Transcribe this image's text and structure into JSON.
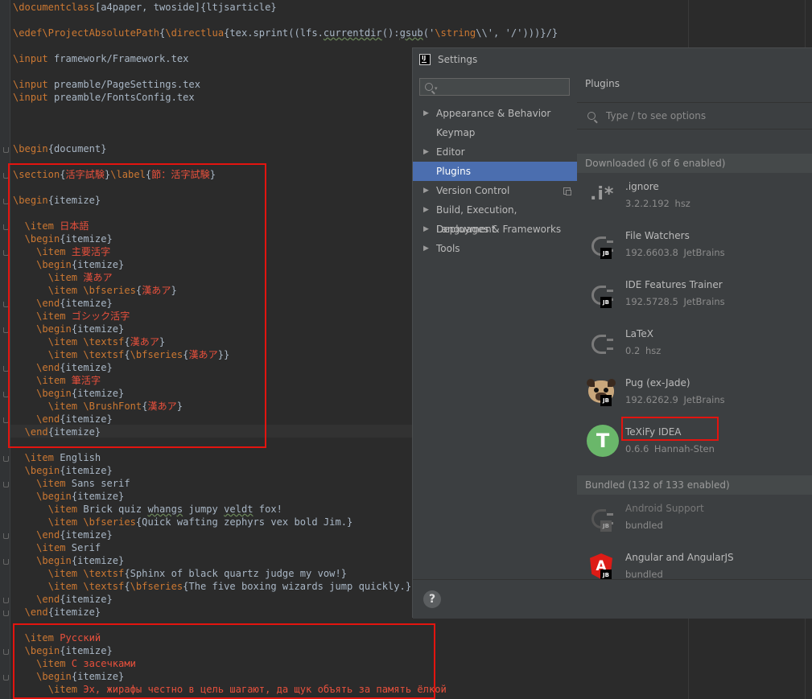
{
  "editor": {
    "lines": [
      [
        {
          "t": "\\documentclass",
          "c": "kw"
        },
        {
          "t": "[a4paper, twoside]{ltjsarticle}"
        }
      ],
      [],
      [
        {
          "t": "\\edef",
          "c": "kw"
        },
        {
          "t": "\\ProjectAbsolutePath",
          "c": "kw"
        },
        {
          "t": "{"
        },
        {
          "t": "\\directlua",
          "c": "kw"
        },
        {
          "t": "{tex.sprint((lfs."
        },
        {
          "t": "currentdir",
          "c": "sq"
        },
        {
          "t": "():"
        },
        {
          "t": "gsub",
          "c": "sq"
        },
        {
          "t": "('"
        },
        {
          "t": "\\string",
          "c": "kw"
        },
        {
          "t": "\\\\', '/')))}/}"
        }
      ],
      [],
      [
        {
          "t": "\\input",
          "c": "kw"
        },
        {
          "t": " framework/Framework.tex"
        }
      ],
      [],
      [
        {
          "t": "\\input",
          "c": "kw"
        },
        {
          "t": " preamble/PageSettings.tex"
        }
      ],
      [
        {
          "t": "\\input",
          "c": "kw"
        },
        {
          "t": " preamble/FontsConfig.tex"
        }
      ],
      [],
      [],
      [],
      [
        {
          "t": "\\begin",
          "c": "kw"
        },
        {
          "t": "{document}"
        }
      ],
      [],
      [
        {
          "t": "\\section",
          "c": "kw"
        },
        {
          "t": "{"
        },
        {
          "t": "活字試験",
          "c": "rd"
        },
        {
          "t": "}"
        },
        {
          "t": "\\label",
          "c": "kw"
        },
        {
          "t": "{"
        },
        {
          "t": "節：活字試験",
          "c": "rd"
        },
        {
          "t": "}"
        }
      ],
      [],
      [
        {
          "t": "\\begin",
          "c": "kw"
        },
        {
          "t": "{itemize}"
        }
      ],
      [],
      [
        {
          "t": "  "
        },
        {
          "t": "\\item",
          "c": "kw"
        },
        {
          "t": " 日本語",
          "c": "rd"
        }
      ],
      [
        {
          "t": "  "
        },
        {
          "t": "\\begin",
          "c": "kw"
        },
        {
          "t": "{itemize}"
        }
      ],
      [
        {
          "t": "    "
        },
        {
          "t": "\\item",
          "c": "kw"
        },
        {
          "t": " 主要活字",
          "c": "rd"
        }
      ],
      [
        {
          "t": "    "
        },
        {
          "t": "\\begin",
          "c": "kw"
        },
        {
          "t": "{itemize}"
        }
      ],
      [
        {
          "t": "      "
        },
        {
          "t": "\\item",
          "c": "kw"
        },
        {
          "t": " 漢あア",
          "c": "rd"
        }
      ],
      [
        {
          "t": "      "
        },
        {
          "t": "\\item",
          "c": "kw"
        },
        {
          "t": " "
        },
        {
          "t": "\\bfseries",
          "c": "kw"
        },
        {
          "t": "{"
        },
        {
          "t": "漢あア",
          "c": "rd"
        },
        {
          "t": "}"
        }
      ],
      [
        {
          "t": "    "
        },
        {
          "t": "\\end",
          "c": "kw"
        },
        {
          "t": "{itemize}"
        }
      ],
      [
        {
          "t": "    "
        },
        {
          "t": "\\item",
          "c": "kw"
        },
        {
          "t": " ゴシック活字",
          "c": "rd"
        }
      ],
      [
        {
          "t": "    "
        },
        {
          "t": "\\begin",
          "c": "kw"
        },
        {
          "t": "{itemize}"
        }
      ],
      [
        {
          "t": "      "
        },
        {
          "t": "\\item",
          "c": "kw"
        },
        {
          "t": " "
        },
        {
          "t": "\\textsf",
          "c": "kw"
        },
        {
          "t": "{"
        },
        {
          "t": "漢あア",
          "c": "rd"
        },
        {
          "t": "}"
        }
      ],
      [
        {
          "t": "      "
        },
        {
          "t": "\\item",
          "c": "kw"
        },
        {
          "t": " "
        },
        {
          "t": "\\textsf",
          "c": "kw"
        },
        {
          "t": "{"
        },
        {
          "t": "\\bfseries",
          "c": "kw"
        },
        {
          "t": "{"
        },
        {
          "t": "漢あア",
          "c": "rd"
        },
        {
          "t": "}}"
        }
      ],
      [
        {
          "t": "    "
        },
        {
          "t": "\\end",
          "c": "kw"
        },
        {
          "t": "{itemize}"
        }
      ],
      [
        {
          "t": "    "
        },
        {
          "t": "\\item",
          "c": "kw"
        },
        {
          "t": " 筆活字",
          "c": "rd"
        }
      ],
      [
        {
          "t": "    "
        },
        {
          "t": "\\begin",
          "c": "kw"
        },
        {
          "t": "{itemize}"
        }
      ],
      [
        {
          "t": "      "
        },
        {
          "t": "\\item",
          "c": "kw"
        },
        {
          "t": " "
        },
        {
          "t": "\\BrushFont",
          "c": "kw"
        },
        {
          "t": "{"
        },
        {
          "t": "漢あア",
          "c": "rd"
        },
        {
          "t": "}"
        }
      ],
      [
        {
          "t": "    "
        },
        {
          "t": "\\end",
          "c": "kw"
        },
        {
          "t": "{itemize}"
        }
      ],
      [
        {
          "t": "  "
        },
        {
          "t": "\\end",
          "c": "kw"
        },
        {
          "t": "{itemize}"
        }
      ],
      [],
      [
        {
          "t": "  "
        },
        {
          "t": "\\item",
          "c": "kw"
        },
        {
          "t": " English"
        }
      ],
      [
        {
          "t": "  "
        },
        {
          "t": "\\begin",
          "c": "kw"
        },
        {
          "t": "{itemize}"
        }
      ],
      [
        {
          "t": "    "
        },
        {
          "t": "\\item",
          "c": "kw"
        },
        {
          "t": " Sans serif"
        }
      ],
      [
        {
          "t": "    "
        },
        {
          "t": "\\begin",
          "c": "kw"
        },
        {
          "t": "{itemize}"
        }
      ],
      [
        {
          "t": "      "
        },
        {
          "t": "\\item",
          "c": "kw"
        },
        {
          "t": " Brick quiz "
        },
        {
          "t": "whangs",
          "c": "sq"
        },
        {
          "t": " jumpy "
        },
        {
          "t": "veldt",
          "c": "sq"
        },
        {
          "t": " fox!"
        }
      ],
      [
        {
          "t": "      "
        },
        {
          "t": "\\item",
          "c": "kw"
        },
        {
          "t": " "
        },
        {
          "t": "\\bfseries",
          "c": "kw"
        },
        {
          "t": "{Quick wafting zephyrs vex bold Jim.}"
        }
      ],
      [
        {
          "t": "    "
        },
        {
          "t": "\\end",
          "c": "kw"
        },
        {
          "t": "{itemize}"
        }
      ],
      [
        {
          "t": "    "
        },
        {
          "t": "\\item",
          "c": "kw"
        },
        {
          "t": " Serif"
        }
      ],
      [
        {
          "t": "    "
        },
        {
          "t": "\\begin",
          "c": "kw"
        },
        {
          "t": "{itemize}"
        }
      ],
      [
        {
          "t": "      "
        },
        {
          "t": "\\item",
          "c": "kw"
        },
        {
          "t": " "
        },
        {
          "t": "\\textsf",
          "c": "kw"
        },
        {
          "t": "{Sphinx of black quartz judge my vow!}"
        }
      ],
      [
        {
          "t": "      "
        },
        {
          "t": "\\item",
          "c": "kw"
        },
        {
          "t": " "
        },
        {
          "t": "\\textsf",
          "c": "kw"
        },
        {
          "t": "{"
        },
        {
          "t": "\\bfseries",
          "c": "kw"
        },
        {
          "t": "{The five boxing wizards jump quickly.}}"
        }
      ],
      [
        {
          "t": "    "
        },
        {
          "t": "\\end",
          "c": "kw"
        },
        {
          "t": "{itemize}"
        }
      ],
      [
        {
          "t": "  "
        },
        {
          "t": "\\end",
          "c": "kw"
        },
        {
          "t": "{itemize}"
        }
      ],
      [],
      [
        {
          "t": "  "
        },
        {
          "t": "\\item",
          "c": "kw"
        },
        {
          "t": " Русский",
          "c": "rd"
        }
      ],
      [
        {
          "t": "  "
        },
        {
          "t": "\\begin",
          "c": "kw"
        },
        {
          "t": "{itemize}"
        }
      ],
      [
        {
          "t": "    "
        },
        {
          "t": "\\item",
          "c": "kw"
        },
        {
          "t": " С засечками",
          "c": "rd"
        }
      ],
      [
        {
          "t": "    "
        },
        {
          "t": "\\begin",
          "c": "kw"
        },
        {
          "t": "{itemize}"
        }
      ],
      [
        {
          "t": "      "
        },
        {
          "t": "\\item",
          "c": "kw"
        },
        {
          "t": " Эх, жирафы честно в цель шагают, да щук объять за память ёлкой",
          "c": "rd"
        }
      ]
    ]
  },
  "settings": {
    "title": "Settings",
    "app_icon_label": "IJ",
    "search_value": "",
    "nav": [
      {
        "label": "Appearance & Behavior",
        "arrow": "▶"
      },
      {
        "label": "Keymap",
        "arrow": ""
      },
      {
        "label": "Editor",
        "arrow": "▶"
      },
      {
        "label": "Plugins",
        "arrow": "",
        "selected": true
      },
      {
        "label": "Version Control",
        "arrow": "▶"
      },
      {
        "label": "Build, Execution, Deployment",
        "arrow": "▶"
      },
      {
        "label": "Languages & Frameworks",
        "arrow": "▶"
      },
      {
        "label": "Tools",
        "arrow": "▶"
      }
    ],
    "plugins_header": "Plugins",
    "options_placeholder": "Type / to see options",
    "downloaded_header": "Downloaded (6 of 6 enabled)",
    "bundled_header": "Bundled (132 of 133 enabled)",
    "downloaded": [
      {
        "name": ".ignore",
        "version": "3.2.2.192",
        "vendor": "hsz",
        "icon": "dot-ignore-icon"
      },
      {
        "name": "File Watchers",
        "version": "192.6603.8",
        "vendor": "JetBrains",
        "icon": "plugin-plug-icon",
        "jb": true
      },
      {
        "name": "IDE Features Trainer",
        "version": "192.5728.5",
        "vendor": "JetBrains",
        "icon": "plugin-plug-icon",
        "jb": true
      },
      {
        "name": "LaTeX",
        "version": "0.2",
        "vendor": "hsz",
        "icon": "plugin-plug-icon"
      },
      {
        "name": "Pug (ex-Jade)",
        "version": "192.6262.9",
        "vendor": "JetBrains",
        "icon": "pug-icon",
        "jb": true
      },
      {
        "name": "TeXiFy IDEA",
        "version": "0.6.6",
        "vendor": "Hannah-Sten",
        "icon": "texify-icon"
      }
    ],
    "bundled": [
      {
        "name": "Android Support",
        "version": "",
        "vendor": "bundled",
        "icon": "plugin-plug-icon",
        "jb": true,
        "dim": true
      },
      {
        "name": "Angular and AngularJS",
        "version": "",
        "vendor": "bundled",
        "icon": "angular-icon",
        "jb": true
      }
    ],
    "jb_badge": "JB",
    "texify_letter": "T",
    "angular_letter": "A",
    "dot_ignore_glyph": ".i*",
    "help_label": "?"
  },
  "colors": {
    "keyword": "#cc7832",
    "red_text": "#e8503c",
    "default_text": "#a9b7c6",
    "selection": "#4b6eaf",
    "highlight_box": "#e3140f"
  }
}
